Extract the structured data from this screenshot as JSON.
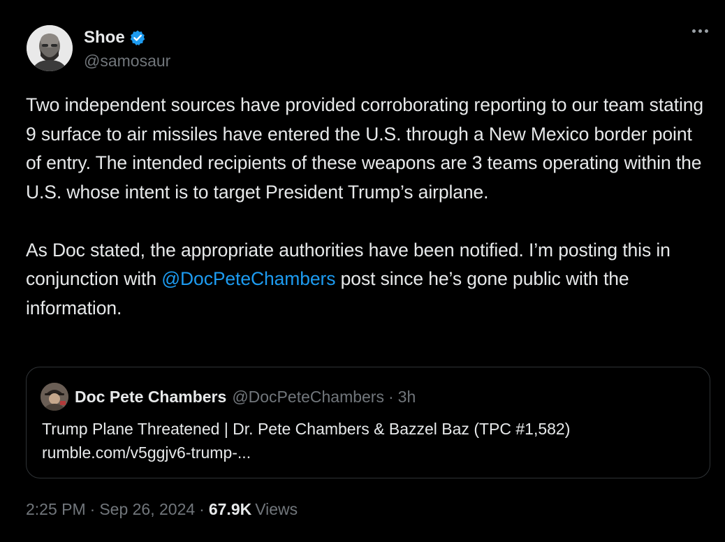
{
  "author": {
    "display_name": "Shoe",
    "handle": "@samosaur",
    "verified": true,
    "avatar_icon": "bald-man-portrait"
  },
  "tweet": {
    "paragraph1": "Two independent sources have provided corroborating reporting to our team stating 9 surface to air missiles have entered the U.S. through a New Mexico border point of entry. The intended recipients of these weapons are 3 teams operating within the U.S. whose intent is to target President Trump’s airplane.",
    "paragraph2_before": "As Doc stated, the appropriate authorities have been notified. I’m posting this in conjunction with ",
    "paragraph2_mention": "@DocPeteChambers",
    "paragraph2_after": " post since he’s gone public with the information."
  },
  "quoted": {
    "display_name": "Doc Pete Chambers",
    "handle": "@DocPeteChambers",
    "separator": "·",
    "time": "3h",
    "title": "Trump Plane Threatened | Dr. Pete Chambers & Bazzel Baz (TPC #1,582)",
    "link": "rumble.com/v5ggjv6-trump-..."
  },
  "meta": {
    "time": "2:25 PM",
    "separator": "·",
    "date": "Sep 26, 2024",
    "views_count": "67.9K",
    "views_label": "Views"
  },
  "colors": {
    "background": "#000000",
    "text": "#e7e9ea",
    "secondary": "#71767b",
    "link": "#1d9bf0",
    "verified": "#1d9bf0",
    "border": "#2f3336"
  }
}
